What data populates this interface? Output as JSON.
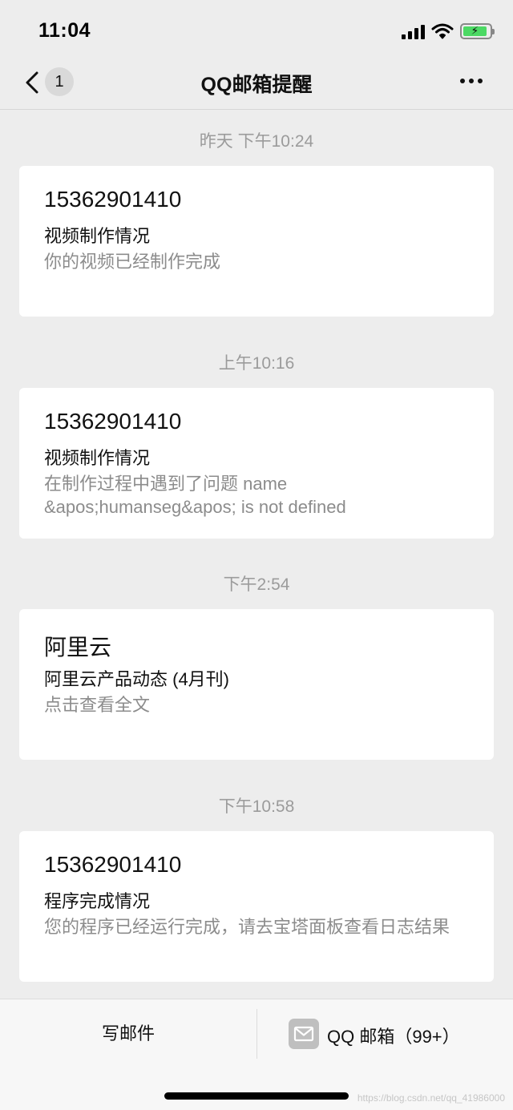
{
  "status_bar": {
    "time": "11:04",
    "battery_level": 0.9,
    "icons": [
      "signal-icon",
      "wifi-icon",
      "battery-charging-icon"
    ]
  },
  "nav": {
    "back_icon": "chevron-left-icon",
    "unread_count": "1",
    "title": "QQ邮箱提醒",
    "more_icon": "ellipsis-icon"
  },
  "messages": [
    {
      "time": "昨天 下午10:24",
      "sender": "15362901410",
      "subject": "视频制作情况",
      "preview": "你的视频已经制作完成"
    },
    {
      "time": "上午10:16",
      "sender": "15362901410",
      "subject": "视频制作情况",
      "preview": "在制作过程中遇到了问题 name &apos;humanseg&apos; is not defined"
    },
    {
      "time": "下午2:54",
      "sender": "阿里云",
      "subject": "阿里云产品动态 (4月刊)",
      "preview": "点击查看全文"
    },
    {
      "time": "下午10:58",
      "sender": "15362901410",
      "subject": "程序完成情况",
      "preview": "您的程序已经运行完成，请去宝塔面板查看日志结果"
    }
  ],
  "bottom_bar": {
    "compose_label": "写邮件",
    "qqmail_label": "QQ 邮箱（99+）",
    "qqmail_icon": "envelope-icon"
  },
  "watermark": "https://blog.csdn.net/qq_41986000",
  "colors": {
    "background": "#ededed",
    "card": "#ffffff",
    "muted_text": "#9b9b9b",
    "battery": "#4cd964"
  }
}
